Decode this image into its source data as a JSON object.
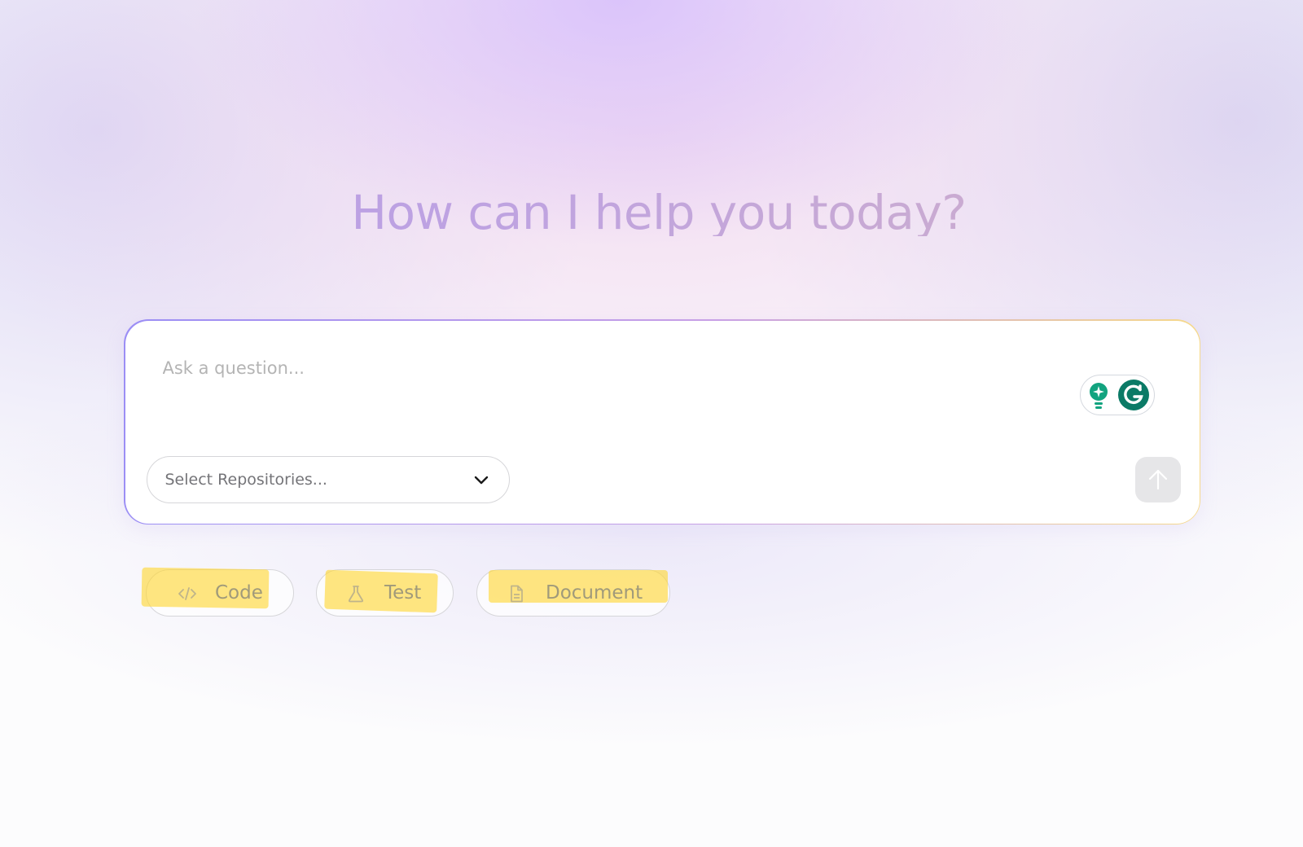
{
  "hero": {
    "title": "How can I help you today?"
  },
  "composer": {
    "placeholder": "Ask a question...",
    "value": "",
    "repo_select": {
      "label": "Select Repositories..."
    },
    "send_button": {
      "icon": "arrow-up-icon",
      "enabled": false
    },
    "assist_widget": {
      "icons": [
        "lightbulb-icon",
        "grammarly-g-icon"
      ],
      "accent": "#12a37f",
      "brand": "#0b7a66"
    }
  },
  "quick_actions": [
    {
      "label": "Code",
      "icon": "code-icon"
    },
    {
      "label": "Test",
      "icon": "flask-icon"
    },
    {
      "label": "Document",
      "icon": "document-icon"
    }
  ],
  "colors": {
    "title_gradient": [
      "#b59ce9",
      "#d2b1c6"
    ],
    "composer_border_gradient": [
      "#9b8ef5",
      "#c8a0e6",
      "#f6d98a"
    ],
    "highlighter": "#ffd632"
  }
}
